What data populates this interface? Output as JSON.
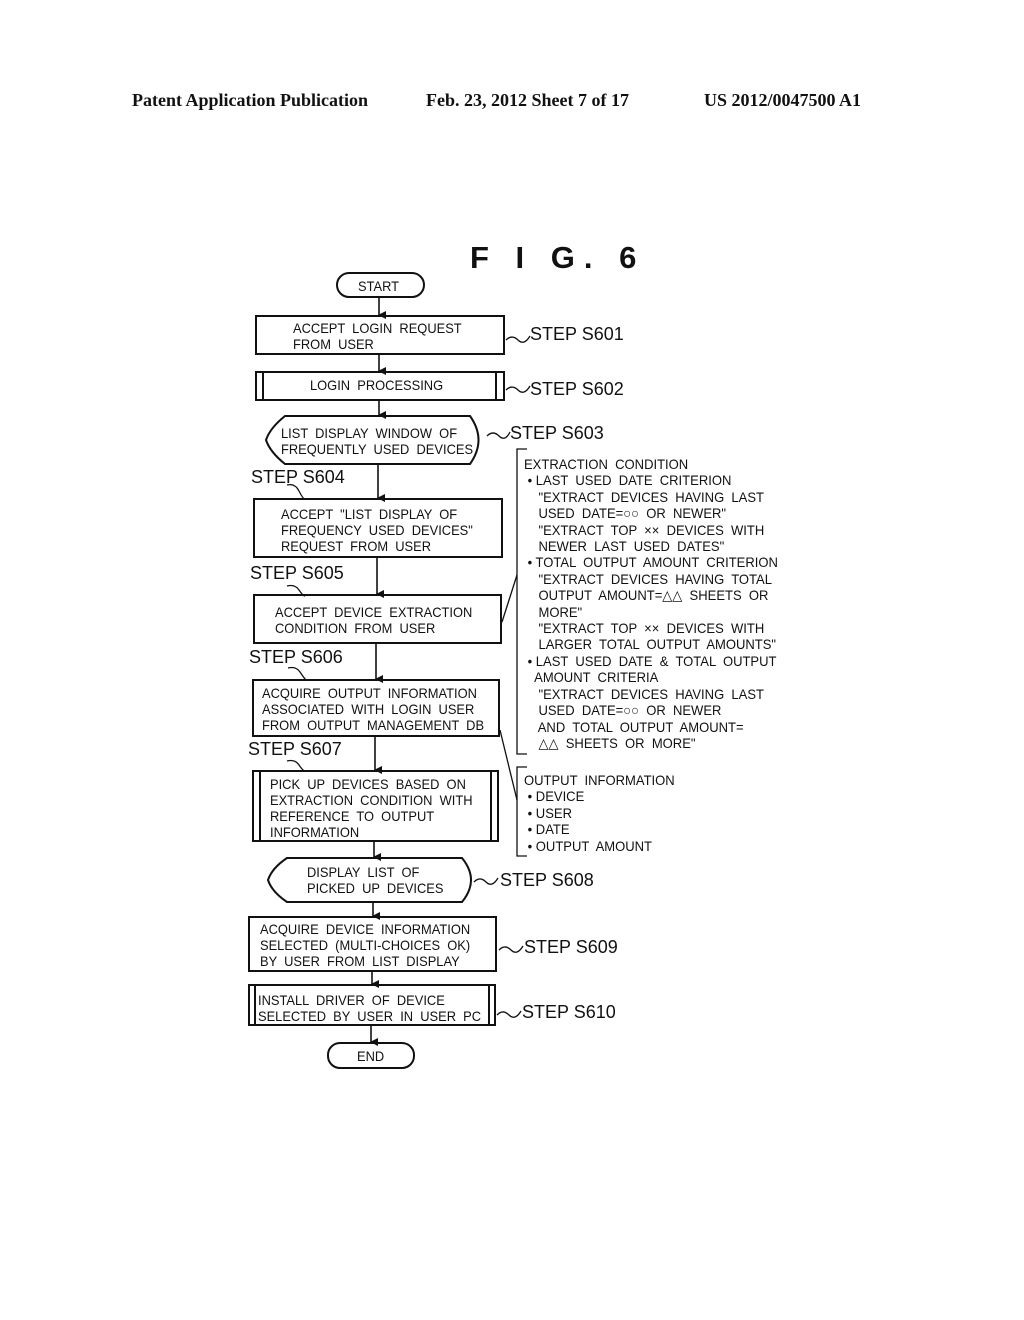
{
  "header": {
    "publication": "Patent Application Publication",
    "date_sheet": "Feb. 23, 2012   Sheet 7 of 17",
    "patent_number": "US 2012/0047500 A1"
  },
  "figure": {
    "title": "F I G. 6",
    "start": "START",
    "end": "END",
    "steps": [
      {
        "id": "S601",
        "label": "STEP  S601",
        "text": "ACCEPT  LOGIN  REQUEST\nFROM  USER",
        "shape": "process"
      },
      {
        "id": "S602",
        "label": "STEP  S602",
        "text": "LOGIN  PROCESSING",
        "shape": "predefined-process"
      },
      {
        "id": "S603",
        "label": "STEP  S603",
        "text": "LIST  DISPLAY  WINDOW  OF\nFREQUENTLY  USED  DEVICES",
        "shape": "display"
      },
      {
        "id": "S604",
        "label": "STEP  S604",
        "text": "ACCEPT  \"LIST  DISPLAY  OF\nFREQUENCY  USED  DEVICES\"\nREQUEST  FROM  USER",
        "shape": "process"
      },
      {
        "id": "S605",
        "label": "STEP  S605",
        "text": "ACCEPT  DEVICE  EXTRACTION\nCONDITION  FROM  USER",
        "shape": "process"
      },
      {
        "id": "S606",
        "label": "STEP  S606",
        "text": "ACQUIRE  OUTPUT  INFORMATION\nASSOCIATED  WITH  LOGIN  USER\nFROM  OUTPUT  MANAGEMENT  DB",
        "shape": "process"
      },
      {
        "id": "S607",
        "label": "STEP  S607",
        "text": "PICK  UP  DEVICES  BASED  ON\nEXTRACTION  CONDITION  WITH\nREFERENCE  TO  OUTPUT\nINFORMATION",
        "shape": "predefined-process"
      },
      {
        "id": "S608",
        "label": "STEP  S608",
        "text": "DISPLAY  LIST  OF\nPICKED  UP  DEVICES",
        "shape": "display"
      },
      {
        "id": "S609",
        "label": "STEP  S609",
        "text": "ACQUIRE  DEVICE  INFORMATION\nSELECTED  (MULTI-CHOICES  OK)\nBY  USER  FROM  LIST  DISPLAY",
        "shape": "process"
      },
      {
        "id": "S610",
        "label": "STEP  S610",
        "text": "INSTALL  DRIVER  OF  DEVICE\nSELECTED  BY  USER  IN  USER  PC",
        "shape": "predefined-process"
      }
    ],
    "annotations": {
      "extraction_condition": "EXTRACTION  CONDITION\n • LAST  USED  DATE  CRITERION\n    \"EXTRACT  DEVICES  HAVING  LAST\n    USED  DATE=○○  OR  NEWER\"\n    \"EXTRACT  TOP  ××  DEVICES  WITH\n    NEWER  LAST  USED  DATES\"\n • TOTAL  OUTPUT  AMOUNT  CRITERION\n    \"EXTRACT  DEVICES  HAVING  TOTAL\n    OUTPUT  AMOUNT=△△  SHEETS  OR\n    MORE\"\n    \"EXTRACT  TOP  ××  DEVICES  WITH\n    LARGER  TOTAL  OUTPUT  AMOUNTS\"\n • LAST  USED  DATE  &  TOTAL  OUTPUT\n   AMOUNT  CRITERIA\n    \"EXTRACT  DEVICES  HAVING  LAST\n    USED  DATE=○○  OR  NEWER\n    AND  TOTAL  OUTPUT  AMOUNT=\n    △△  SHEETS  OR  MORE\"",
      "output_information": "OUTPUT  INFORMATION\n • DEVICE\n • USER\n • DATE\n • OUTPUT  AMOUNT"
    }
  }
}
